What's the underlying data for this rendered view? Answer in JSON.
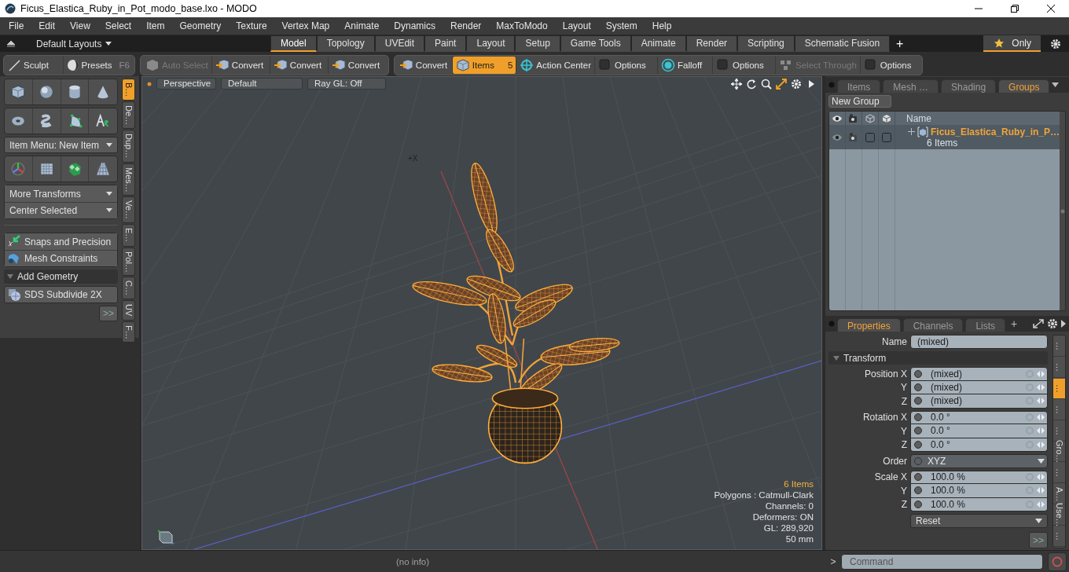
{
  "window": {
    "title": "Ficus_Elastica_Ruby_in_Pot_modo_base.lxo - MODO"
  },
  "menu_bar": [
    "File",
    "Edit",
    "View",
    "Select",
    "Item",
    "Geometry",
    "Texture",
    "Vertex Map",
    "Animate",
    "Dynamics",
    "Render",
    "MaxToModo",
    "Layout",
    "System",
    "Help"
  ],
  "layout_bar": {
    "layouts": "Default Layouts",
    "tabs": [
      {
        "label": "Model",
        "selected": true
      },
      {
        "label": "Topology",
        "selected": false
      },
      {
        "label": "UVEdit",
        "selected": false
      },
      {
        "label": "Paint",
        "selected": false
      },
      {
        "label": "Layout",
        "selected": false
      },
      {
        "label": "Setup",
        "selected": false
      },
      {
        "label": "Game Tools",
        "selected": false
      },
      {
        "label": "Animate",
        "selected": false
      },
      {
        "label": "Render",
        "selected": false
      },
      {
        "label": "Scripting",
        "selected": false
      },
      {
        "label": "Schematic Fusion",
        "selected": false
      }
    ],
    "add": "+",
    "only": {
      "label": "Only",
      "selected": true
    }
  },
  "toolbox": {
    "tabs": [
      {
        "label": "Sculpt"
      },
      {
        "label": "Presets",
        "shortcut": "F6"
      }
    ],
    "item_menu": "Item Menu: New Item",
    "transforms": [
      "More Transforms",
      "Center Selected"
    ],
    "tools": [
      "Snaps and Precision",
      "Mesh Constraints"
    ],
    "section": {
      "label": "Add Geometry",
      "expanded": true
    },
    "subdivide": "SDS Subdivide 2X",
    "more": ">>",
    "side_tabs": [
      {
        "label": "B…",
        "selected": true
      },
      {
        "label": "De…",
        "selected": false
      },
      {
        "label": "Dup…",
        "selected": false
      },
      {
        "label": "Mes…",
        "selected": false
      },
      {
        "label": "Ve…",
        "selected": false
      },
      {
        "label": "E…",
        "selected": false
      },
      {
        "label": "Pol…",
        "selected": false
      },
      {
        "label": "C…",
        "selected": false
      },
      {
        "label": "UV",
        "selected": false
      },
      {
        "label": "F…",
        "selected": false
      }
    ]
  },
  "toolbar": {
    "groups": [
      [
        {
          "label": "Auto Select",
          "disabled": true,
          "selected": false
        },
        {
          "label": "Convert",
          "disabled": false,
          "selected": false
        },
        {
          "label": "Convert",
          "disabled": false,
          "selected": false
        },
        {
          "label": "Convert",
          "disabled": false,
          "selected": false
        }
      ],
      [
        {
          "label": "Convert",
          "disabled": false,
          "selected": false
        },
        {
          "label": "Items",
          "disabled": false,
          "selected": true,
          "shortcut": "5"
        },
        {
          "label": "Action Center",
          "disabled": false,
          "selected": false
        },
        {
          "label": "Options",
          "disabled": false,
          "selected": false
        },
        {
          "label": "Falloff",
          "disabled": false,
          "selected": false
        },
        {
          "label": "Options",
          "disabled": false,
          "selected": false
        },
        {
          "label": "Select Through",
          "disabled": true,
          "selected": false
        },
        {
          "label": "Options",
          "disabled": false,
          "selected": false
        }
      ]
    ]
  },
  "viewport": {
    "buttons": [
      "Perspective",
      "Default",
      "Ray GL: Off"
    ],
    "axis_label": "+X",
    "info": [
      {
        "text": "6 Items",
        "highlight": true
      },
      {
        "text": "Polygons : Catmull-Clark",
        "highlight": false
      },
      {
        "text": "Channels: 0",
        "highlight": false
      },
      {
        "text": "Deformers: ON",
        "highlight": false
      },
      {
        "text": "GL: 289,920",
        "highlight": false
      },
      {
        "text": "50 mm",
        "highlight": false
      }
    ]
  },
  "groups_panel": {
    "tabs": [
      {
        "label": "Items",
        "selected": false
      },
      {
        "label": "Mesh …",
        "selected": false
      },
      {
        "label": "Shading",
        "selected": false
      },
      {
        "label": "Groups",
        "selected": true
      }
    ],
    "new_group": "New Group",
    "column": "Name",
    "rows": [
      {
        "name": "Ficus_Elastica_Ruby_in_P…",
        "detail": "6 Items",
        "selected": true
      }
    ]
  },
  "properties": {
    "tabs": [
      {
        "label": "Properties",
        "selected": true
      },
      {
        "label": "Channels",
        "selected": false
      },
      {
        "label": "Lists",
        "selected": false
      }
    ],
    "add": "+",
    "name_label": "Name",
    "name_value": "(mixed)",
    "section": {
      "label": "Transform",
      "expanded": true
    },
    "transform": [
      [
        {
          "label": "Position X",
          "value": "(mixed)",
          "kind": "field"
        },
        {
          "label": "Y",
          "value": "(mixed)",
          "kind": "field"
        },
        {
          "label": "Z",
          "value": "(mixed)",
          "kind": "field"
        }
      ],
      [
        {
          "label": "Rotation X",
          "value": "0.0 °",
          "kind": "field"
        },
        {
          "label": "Y",
          "value": "0.0 °",
          "kind": "field"
        },
        {
          "label": "Z",
          "value": "0.0 °",
          "kind": "field"
        }
      ],
      [
        {
          "label": "Order",
          "value": "XYZ",
          "kind": "dropdown"
        }
      ],
      [
        {
          "label": "Scale X",
          "value": "100.0 %",
          "kind": "field"
        },
        {
          "label": "Y",
          "value": "100.0 %",
          "kind": "field"
        },
        {
          "label": "Z",
          "value": "100.0 %",
          "kind": "field"
        }
      ]
    ],
    "reset": "Reset",
    "more": ">>",
    "side_tabs": [
      {
        "label": "…",
        "selected": false
      },
      {
        "label": "…",
        "selected": false
      },
      {
        "label": "…",
        "selected": true
      },
      {
        "label": "…",
        "selected": false
      },
      {
        "label": "…",
        "selected": false
      },
      {
        "label": "Gro…",
        "selected": false
      },
      {
        "label": "…",
        "selected": false
      },
      {
        "label": "A…",
        "selected": false
      },
      {
        "label": "Use…",
        "selected": false
      },
      {
        "label": "…",
        "selected": false
      }
    ]
  },
  "status_bar": {
    "info": "(no info)",
    "prompt": ">",
    "command_placeholder": "Command"
  }
}
